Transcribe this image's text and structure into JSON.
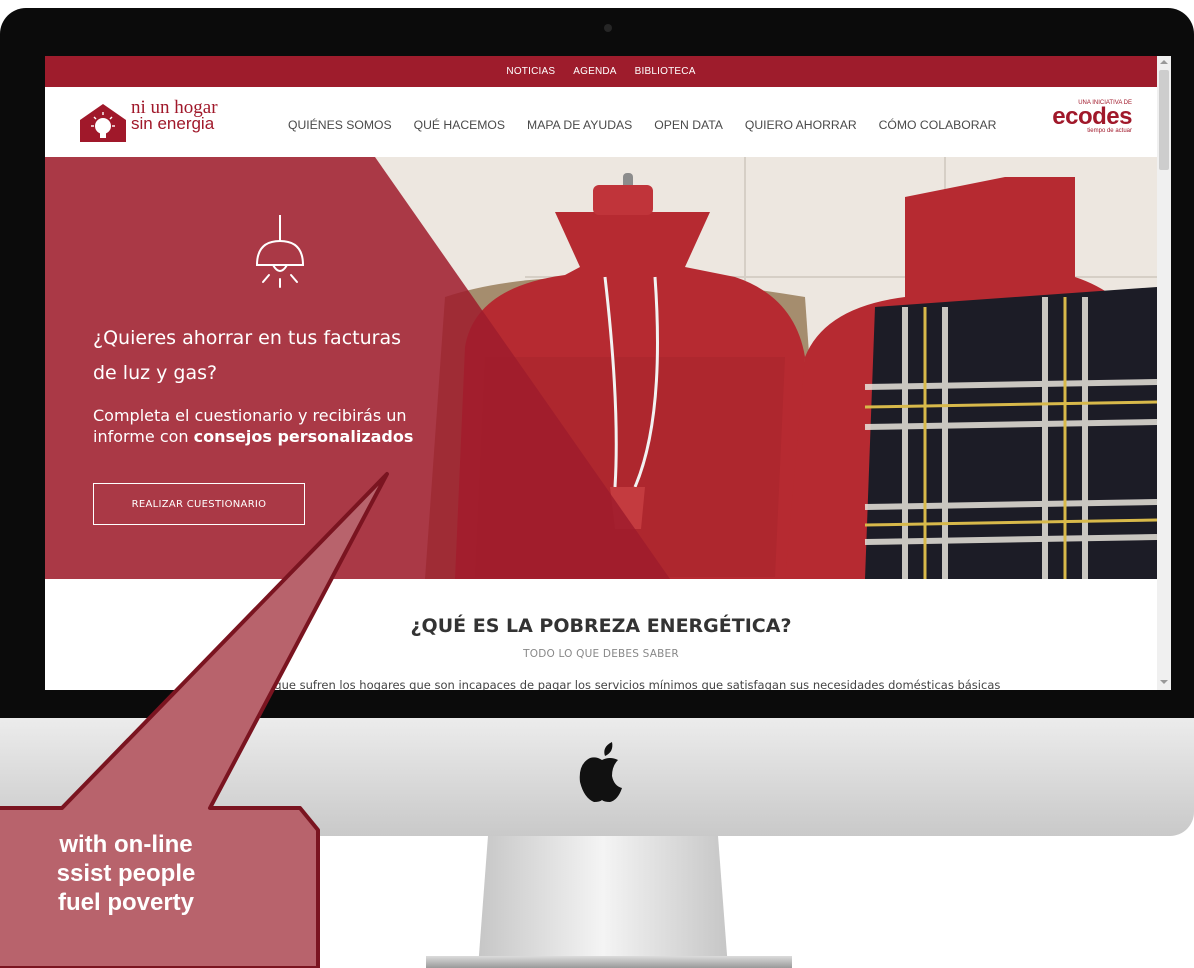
{
  "topbar": {
    "links": [
      "NOTICIAS",
      "AGENDA",
      "BIBLIOTECA"
    ]
  },
  "logo": {
    "line1": "ni un hogar",
    "line2": "sin energia"
  },
  "nav": {
    "items": [
      "QUIÉNES SOMOS",
      "QUÉ HACEMOS",
      "MAPA DE AYUDAS",
      "OPEN DATA",
      "QUIERO AHORRAR",
      "CÓMO COLABORAR"
    ]
  },
  "partner": {
    "initiative": "UNA INICIATIVA DE",
    "brand": "ecodes",
    "tagline": "tiempo de actuar"
  },
  "hero": {
    "heading_line1": "¿Quieres ahorrar en tus facturas",
    "heading_line2": "de luz y gas?",
    "sub_line1": "Completa el cuestionario y recibirás un",
    "sub_line2_prefix": "informe con ",
    "sub_line2_bold": "consejos personalizados",
    "cta": "REALIZAR CUESTIONARIO"
  },
  "section": {
    "title": "¿QUÉ ES LA POBREZA ENERGÉTICA?",
    "subtitle": "TODO LO QUE DEBES SABER",
    "body": "La situación que sufren los hogares que son incapaces de pagar los servicios mínimos que satisfagan sus necesidades domésticas básicas"
  },
  "callout": {
    "line1": "with on-line",
    "line2": "ssist people",
    "line3": "fuel poverty"
  },
  "colors": {
    "brand": "#9e1c2c",
    "callout_fill": "#b8636c",
    "callout_border": "#7a1420"
  }
}
